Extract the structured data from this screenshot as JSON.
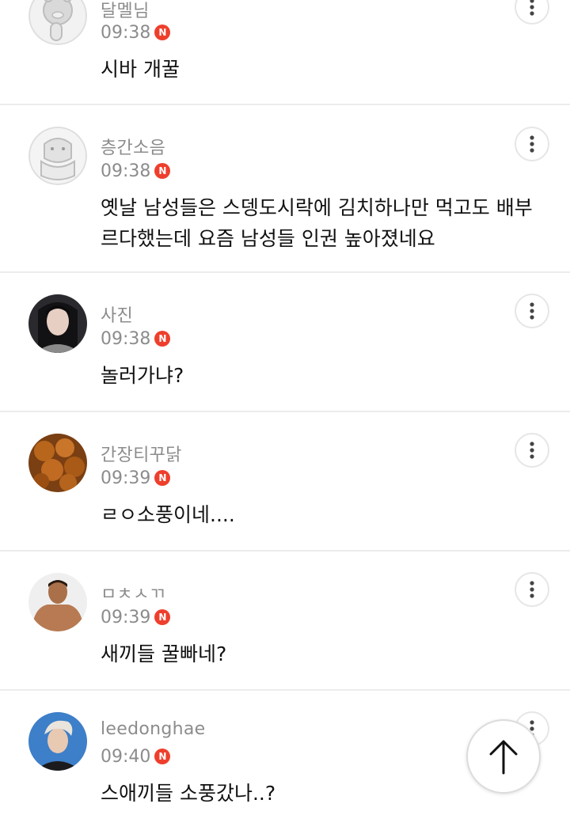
{
  "comments": [
    {
      "username": "달멜님",
      "time": "09:38",
      "badge": "N",
      "text": "시바 개꿀",
      "avatar": "ryan-character-icon"
    },
    {
      "username": "층간소음",
      "time": "09:38",
      "badge": "N",
      "text": "옛날 남성들은 스뎅도시락에 김치하나만 먹고도 배부르다했는데 요즘 남성들 인권 높아졌네요",
      "avatar": "ryan-character-icon"
    },
    {
      "username": "사진",
      "time": "09:38",
      "badge": "N",
      "text": "놀러가냐?",
      "avatar": "portrait-photo"
    },
    {
      "username": "간장티꾸닭",
      "time": "09:39",
      "badge": "N",
      "text": "ㄹㅇ소풍이네....",
      "avatar": "fried-chicken-photo"
    },
    {
      "username": "ㅁㅊㅅㄲ",
      "time": "09:39",
      "badge": "N",
      "text": "새끼들 꿀빠네?",
      "avatar": "portrait-photo"
    },
    {
      "username": "leedonghae",
      "time": "09:40",
      "badge": "N",
      "text": "스애끼들 소풍갔나..?",
      "avatar": "portrait-photo"
    }
  ],
  "colors": {
    "badge": "#ee3f2c",
    "meta_text": "#8c8c8c",
    "divider": "#ececec"
  },
  "icons": {
    "more": "more-vertical-icon",
    "scroll_top": "arrow-up-icon"
  }
}
